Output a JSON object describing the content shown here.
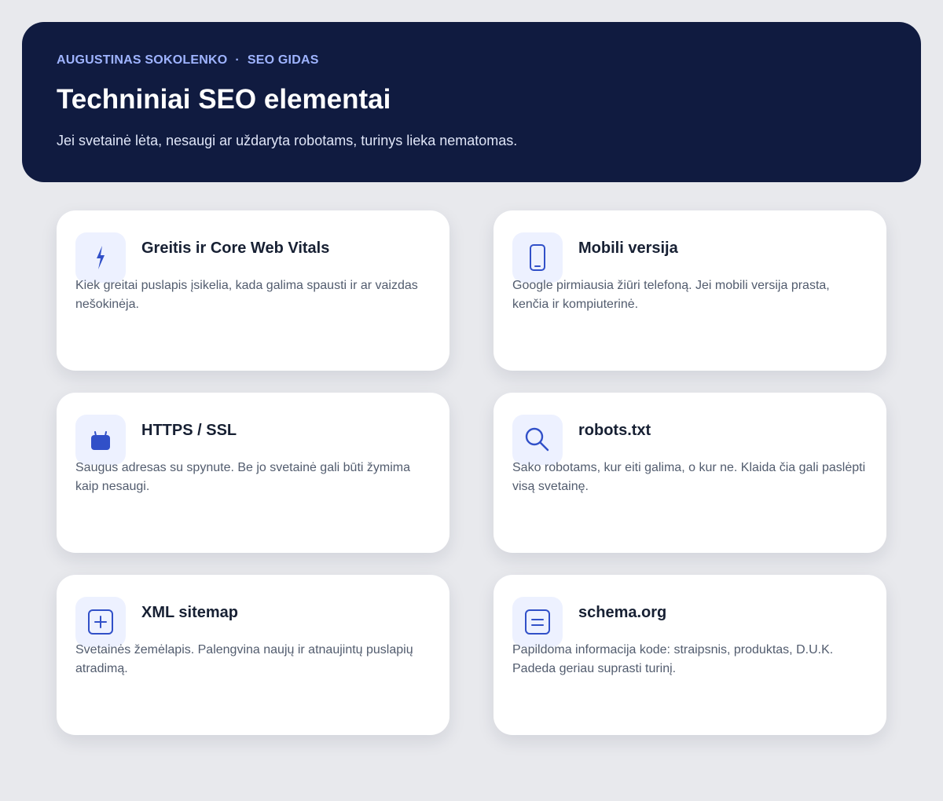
{
  "header": {
    "author": "AUGUSTINAS SOKOLENKO",
    "separator": "·",
    "section": "SEO GIDAS",
    "title": "Techniniai SEO elementai",
    "subtitle": "Jei svetainė lėta, nesaugi ar uždaryta robotams, turinys lieka nematomas."
  },
  "colors": {
    "page_background": "#e8e9ed",
    "hero_background": "#101b40",
    "accent": "#3150c8",
    "icon_tile": "#edf1ff"
  },
  "cards": [
    {
      "icon": "lightning-icon",
      "title": "Greitis ir Core Web Vitals",
      "text": "Kiek greitai puslapis įsikelia, kada galima spausti ir ar vaizdas nešokinėja."
    },
    {
      "icon": "smartphone-icon",
      "title": "Mobili versija",
      "text": "Google pirmiausia žiūri telefoną. Jei mobili versija prasta, kenčia ir kompiuterinė."
    },
    {
      "icon": "lock-icon",
      "title": "HTTPS / SSL",
      "text": "Saugus adresas su spynute. Be jo svetainė gali būti žymima kaip nesaugi."
    },
    {
      "icon": "magnifier-icon",
      "title": "robots.txt",
      "text": "Sako robotams, kur eiti galima, o kur ne. Klaida čia gali paslėpti visą svetainę."
    },
    {
      "icon": "plus-square-icon",
      "title": "XML sitemap",
      "text": "Svetainės žemėlapis. Palengvina naujų ir atnaujintų puslapių atradimą."
    },
    {
      "icon": "document-lines-icon",
      "title": "schema.org",
      "text": "Papildoma informacija kode: straipsnis, produktas, D.U.K. Padeda geriau suprasti turinį."
    }
  ]
}
